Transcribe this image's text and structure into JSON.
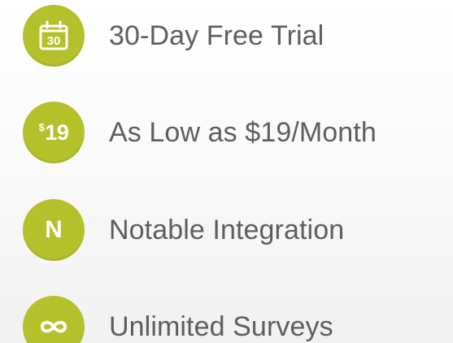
{
  "colors": {
    "badge": "#b4c12a",
    "text": "#5e5e5e",
    "background": "#ffffff"
  },
  "features": [
    {
      "icon": "calendar-icon",
      "badge_text": "30",
      "label": "30-Day Free Trial"
    },
    {
      "icon": "price-icon",
      "badge_currency": "$",
      "badge_amount": "19",
      "label": "As Low as $19/Month"
    },
    {
      "icon": "notable-n-icon",
      "badge_text": "N",
      "label": "Notable Integration"
    },
    {
      "icon": "infinity-icon",
      "badge_text": "∞",
      "label": "Unlimited Surveys"
    }
  ]
}
